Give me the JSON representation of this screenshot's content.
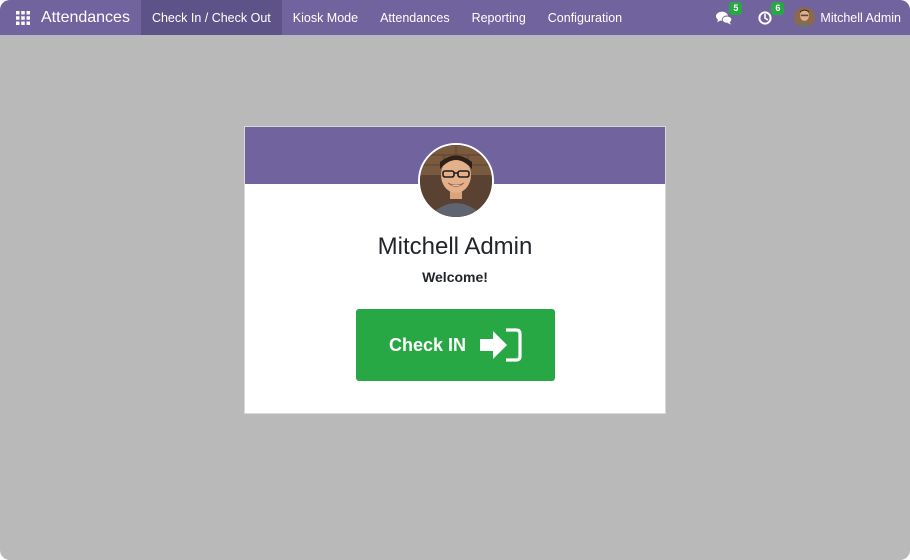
{
  "navbar": {
    "app_title": "Attendances",
    "menu": [
      {
        "label": "Check In / Check Out",
        "active": true
      },
      {
        "label": "Kiosk Mode",
        "active": false
      },
      {
        "label": "Attendances",
        "active": false
      },
      {
        "label": "Reporting",
        "active": false
      },
      {
        "label": "Configuration",
        "active": false
      }
    ],
    "messages_count": "5",
    "activities_count": "6",
    "user_name": "Mitchell Admin"
  },
  "card": {
    "employee_name": "Mitchell Admin",
    "greeting": "Welcome!",
    "button_label": "Check IN"
  },
  "colors": {
    "brand": "#71639e",
    "success": "#28a745",
    "background": "#b8b9b8"
  }
}
